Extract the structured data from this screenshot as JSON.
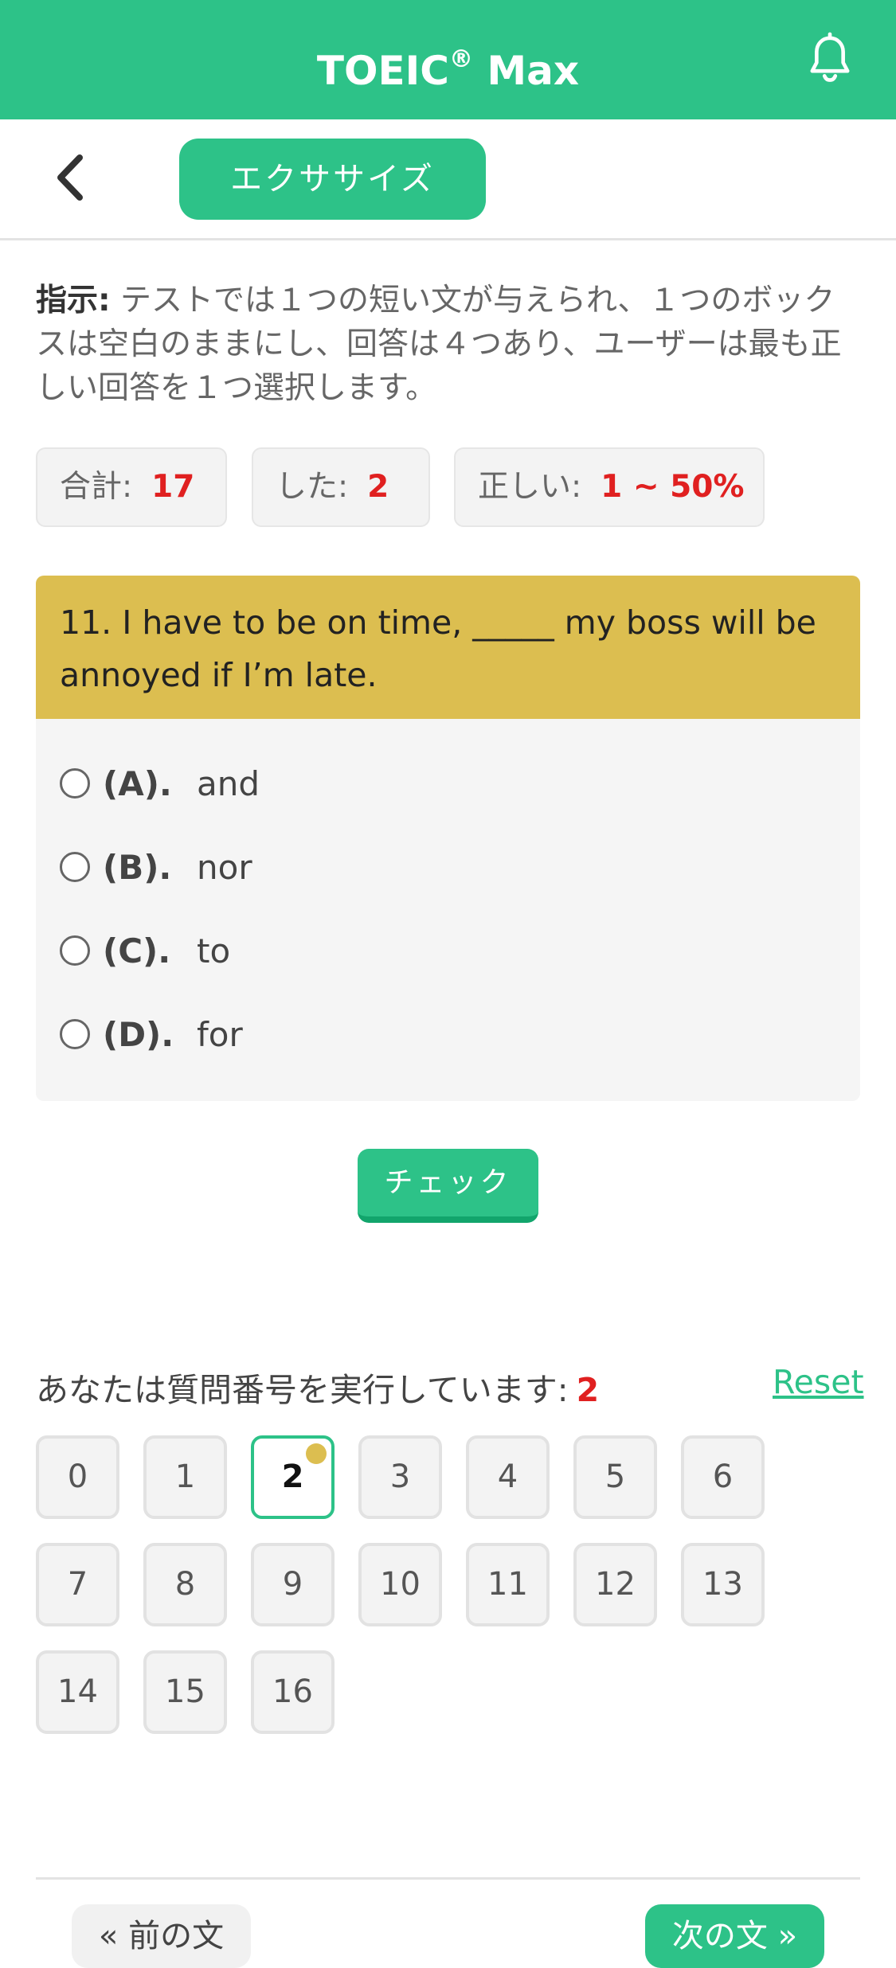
{
  "header": {
    "title_main": "TOEIC",
    "title_reg": "®",
    "title_rest": " Max",
    "bell_icon": "bell-icon",
    "color": "#2dc288"
  },
  "nav": {
    "back_icon": "chevron-left-icon",
    "exercise_label": "エクササイズ"
  },
  "instructions": {
    "label": "指示:",
    "text": " テストでは１つの短い文が与えられ、１つのボックスは空白のままにし、回答は４つあり、ユーザーは最も正しい回答を１つ選択します。"
  },
  "stats": {
    "total_label": "合計:",
    "total_value": "17",
    "done_label": "した:",
    "done_value": "2",
    "correct_label": "正しい:",
    "correct_value": "1 ~ 50%"
  },
  "question": {
    "text": "11. I have to be on time, _____ my boss will be annoyed if I’m late.",
    "head_color": "#dcbe50",
    "options": [
      {
        "letter": "(A).",
        "text": "and"
      },
      {
        "letter": "(B).",
        "text": "nor"
      },
      {
        "letter": "(C).",
        "text": "to"
      },
      {
        "letter": "(D).",
        "text": "for"
      }
    ]
  },
  "check_label": "チェック",
  "progress": {
    "label": "あなたは質問番号を実行しています:",
    "current": "2",
    "reset_label": "Reset",
    "numbers": [
      "0",
      "1",
      "2",
      "3",
      "4",
      "5",
      "6",
      "7",
      "8",
      "9",
      "10",
      "11",
      "12",
      "13",
      "14",
      "15",
      "16"
    ]
  },
  "footer": {
    "prev_label": "« 前の文",
    "next_label": "次の文 »"
  }
}
